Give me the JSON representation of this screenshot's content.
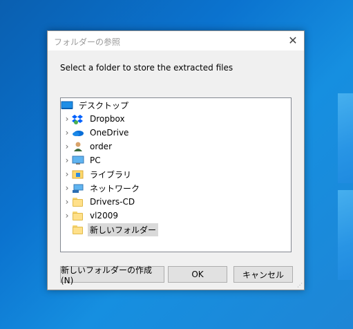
{
  "dialog": {
    "title": "フォルダーの参照",
    "description": "Select a folder to store the extracted files",
    "close_glyph": "✕"
  },
  "tree": {
    "items": [
      {
        "label": "デスクトップ",
        "icon": "desktop-icon",
        "expandable": false
      },
      {
        "label": "Dropbox",
        "icon": "dropbox-icon",
        "expandable": true
      },
      {
        "label": "OneDrive",
        "icon": "onedrive-icon",
        "expandable": true
      },
      {
        "label": "order",
        "icon": "user-icon",
        "expandable": true
      },
      {
        "label": "PC",
        "icon": "pc-icon",
        "expandable": true
      },
      {
        "label": "ライブラリ",
        "icon": "library-icon",
        "expandable": true
      },
      {
        "label": "ネットワーク",
        "icon": "network-icon",
        "expandable": true
      },
      {
        "label": "Drivers-CD",
        "icon": "folder-icon",
        "expandable": true
      },
      {
        "label": "vl2009",
        "icon": "folder-icon",
        "expandable": true
      },
      {
        "label": "新しいフォルダー",
        "icon": "folder-icon",
        "expandable": false,
        "selected": true
      }
    ]
  },
  "buttons": {
    "new_folder": "新しいフォルダーの作成(N)",
    "ok": "OK",
    "cancel": "キャンセル"
  },
  "colors": {
    "selection": "#d9d9d9",
    "desktop_blue": "#0b73cf"
  }
}
